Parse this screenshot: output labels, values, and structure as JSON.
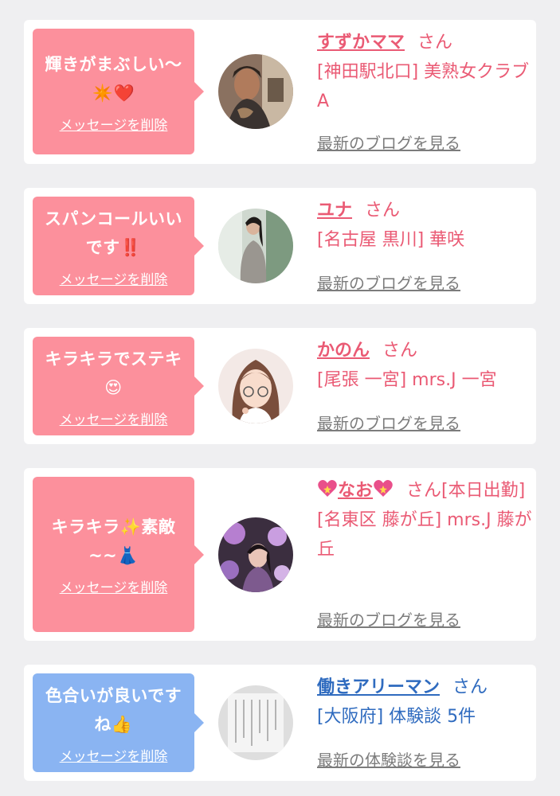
{
  "cards": [
    {
      "message_line1": "輝きがまぶしい〜",
      "message_emoji": "✴️❤️",
      "delete_label": "メッセージを削除",
      "name": "すずかママ",
      "honorific": "さん",
      "store": "[神田駅北口] 美熟女クラブA",
      "link": "最新のブログを見る"
    },
    {
      "message_line1": "スパンコールいい",
      "message_line2": "です‼️",
      "delete_label": "メッセージを削除",
      "name": "ユナ",
      "honorific": "さん",
      "store": "[名古屋 黒川] 華咲",
      "link": "最新のブログを見る"
    },
    {
      "message_line1": "キラキラでステキ",
      "message_emoji": "😍",
      "delete_label": "メッセージを削除",
      "name": "かのん",
      "honorific": "さん",
      "store": "[尾張 一宮] mrs.J 一宮",
      "link": "最新のブログを見る"
    },
    {
      "message_line1": "キラキラ✨素敵",
      "message_line2": "~~👗",
      "delete_label": "メッセージを削除",
      "name": "なお",
      "honorific": "さん",
      "status": "[本日出勤]",
      "store": "[名東区 藤が丘] mrs.J 藤が丘",
      "link": "最新のブログを見る"
    },
    {
      "message_line1": "色合いが良いです",
      "message_line2": "ね👍",
      "delete_label": "メッセージを削除",
      "name": "働きアリーマン",
      "honorific": "さん",
      "store": "[大阪府] 体験談 5件",
      "link": "最新の体験談を見る"
    }
  ],
  "colors": {
    "pink_bubble": "#fc909c",
    "blue_bubble": "#8ab4f2",
    "pink_text": "#ea5a74",
    "blue_text": "#2f6bbf",
    "link_gray": "#7c7c7c",
    "background": "#efeff1"
  }
}
